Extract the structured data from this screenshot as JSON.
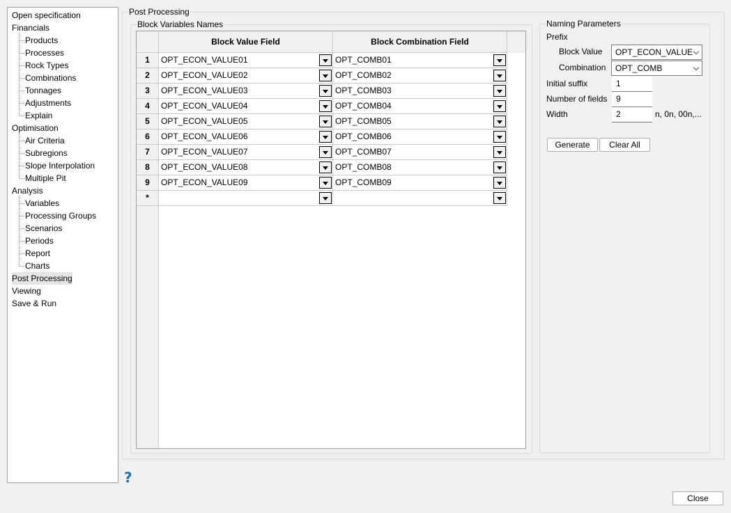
{
  "sidebar": {
    "items": [
      {
        "label": "Open specification",
        "level": 0
      },
      {
        "label": "Financials",
        "level": 0
      },
      {
        "label": "Products",
        "level": 1
      },
      {
        "label": "Processes",
        "level": 1
      },
      {
        "label": "Rock Types",
        "level": 1
      },
      {
        "label": "Combinations",
        "level": 1
      },
      {
        "label": "Tonnages",
        "level": 1
      },
      {
        "label": "Adjustments",
        "level": 1
      },
      {
        "label": "Explain",
        "level": 1
      },
      {
        "label": "Optimisation",
        "level": 0
      },
      {
        "label": "Air Criteria",
        "level": 1
      },
      {
        "label": "Subregions",
        "level": 1
      },
      {
        "label": "Slope Interpolation",
        "level": 1
      },
      {
        "label": "Multiple Pit",
        "level": 1
      },
      {
        "label": "Analysis",
        "level": 0
      },
      {
        "label": "Variables",
        "level": 1
      },
      {
        "label": "Processing Groups",
        "level": 1
      },
      {
        "label": "Scenarios",
        "level": 1
      },
      {
        "label": "Periods",
        "level": 1
      },
      {
        "label": "Report",
        "level": 1
      },
      {
        "label": "Charts",
        "level": 1
      },
      {
        "label": "Post Processing",
        "level": 0,
        "selected": true
      },
      {
        "label": "Viewing",
        "level": 0
      },
      {
        "label": "Save & Run",
        "level": 0
      }
    ]
  },
  "main": {
    "group_title": "Post Processing",
    "block_group_title": "Block Variables Names",
    "grid": {
      "columns": [
        "Block Value Field",
        "Block Combination Field"
      ],
      "rows": [
        {
          "n": "1",
          "value": "OPT_ECON_VALUE01",
          "comb": "OPT_COMB01"
        },
        {
          "n": "2",
          "value": "OPT_ECON_VALUE02",
          "comb": "OPT_COMB02"
        },
        {
          "n": "3",
          "value": "OPT_ECON_VALUE03",
          "comb": "OPT_COMB03"
        },
        {
          "n": "4",
          "value": "OPT_ECON_VALUE04",
          "comb": "OPT_COMB04"
        },
        {
          "n": "5",
          "value": "OPT_ECON_VALUE05",
          "comb": "OPT_COMB05"
        },
        {
          "n": "6",
          "value": "OPT_ECON_VALUE06",
          "comb": "OPT_COMB06"
        },
        {
          "n": "7",
          "value": "OPT_ECON_VALUE07",
          "comb": "OPT_COMB07"
        },
        {
          "n": "8",
          "value": "OPT_ECON_VALUE08",
          "comb": "OPT_COMB08"
        },
        {
          "n": "9",
          "value": "OPT_ECON_VALUE09",
          "comb": "OPT_COMB09"
        },
        {
          "n": "*",
          "value": "",
          "comb": ""
        }
      ]
    }
  },
  "naming": {
    "title": "Naming Parameters",
    "prefix_label": "Prefix",
    "block_value_label": "Block Value",
    "block_value": "OPT_ECON_VALUE",
    "combination_label": "Combination",
    "combination": "OPT_COMB",
    "initial_suffix_label": "Initial suffix",
    "initial_suffix": "1",
    "num_fields_label": "Number of fields",
    "num_fields": "9",
    "width_label": "Width",
    "width": "2",
    "width_hint": "n, 0n, 00n,...",
    "generate": "Generate",
    "clear_all": "Clear All"
  },
  "help": "?",
  "close": "Close"
}
